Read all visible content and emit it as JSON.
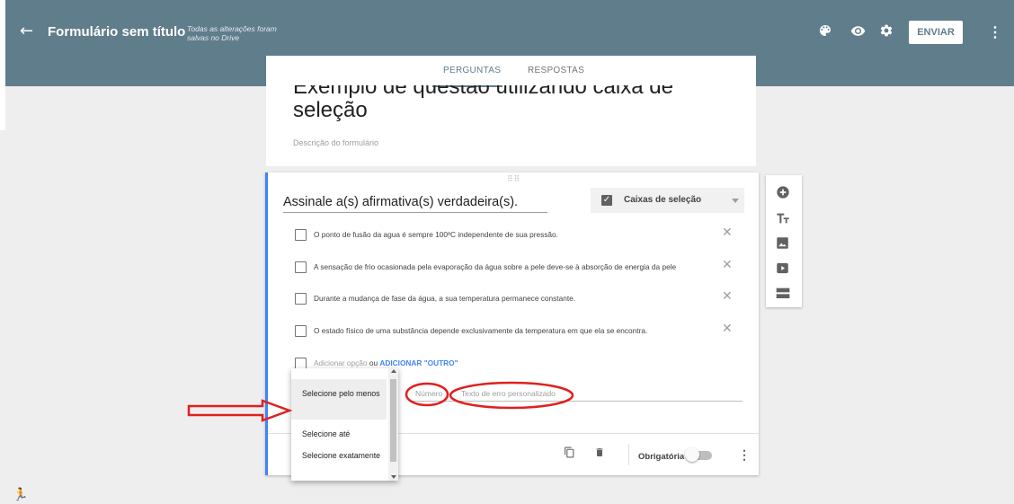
{
  "header": {
    "title": "Formulário sem título",
    "saved_status": "Todas as alterações foram salvas no Drive",
    "send_label": "ENVIAR",
    "color": "#607d8b"
  },
  "tabs": [
    {
      "label": "PERGUNTAS",
      "active": true
    },
    {
      "label": "RESPOSTAS",
      "active": false
    }
  ],
  "form": {
    "title": "seleção",
    "title_partial": "Exemplo de questão utilizando caixa de",
    "description_placeholder": "Descrição do formulário"
  },
  "question": {
    "title": "Assinale a(s) afirmativa(s) verdadeira(s).",
    "type_label": "Caixas de seleção",
    "options": [
      "O ponto de fusão da agua é sempre 100ºC independente de sua pressão.",
      "A sensação de frio ocasionada pela evaporação da água sobre a pele deve-se à absorção de energia da pele",
      "Durante a mudança de fase da água, a sua temperatura permanece constante.",
      "O estado físico de uma substância depende exclusivamente da temperatura em que ela se encontra."
    ],
    "add_option": "Adicionar opção",
    "add_or": "ou",
    "add_other": "ADICIONAR \"OUTRO\"",
    "validation_number_placeholder": "Número",
    "validation_error_placeholder": "Texto de erro personalizado",
    "required_label": "Obrigatória",
    "required": false
  },
  "validation_dropdown": {
    "items": [
      "Selecione pelo menos",
      "Selecione até",
      "Selecione exatamente"
    ],
    "selected_index": 0
  },
  "icons": {
    "back": "arrow-back-icon",
    "palette": "palette-icon",
    "preview": "eye-icon",
    "settings": "gear-icon",
    "more": "more-vert-icon",
    "sidebar": [
      "add-circle-icon",
      "title-icon",
      "image-icon",
      "video-icon",
      "section-icon"
    ],
    "footer": [
      "duplicate-icon",
      "delete-icon"
    ]
  },
  "accent_color": "#4285f4",
  "annotation_color": "#e02020"
}
